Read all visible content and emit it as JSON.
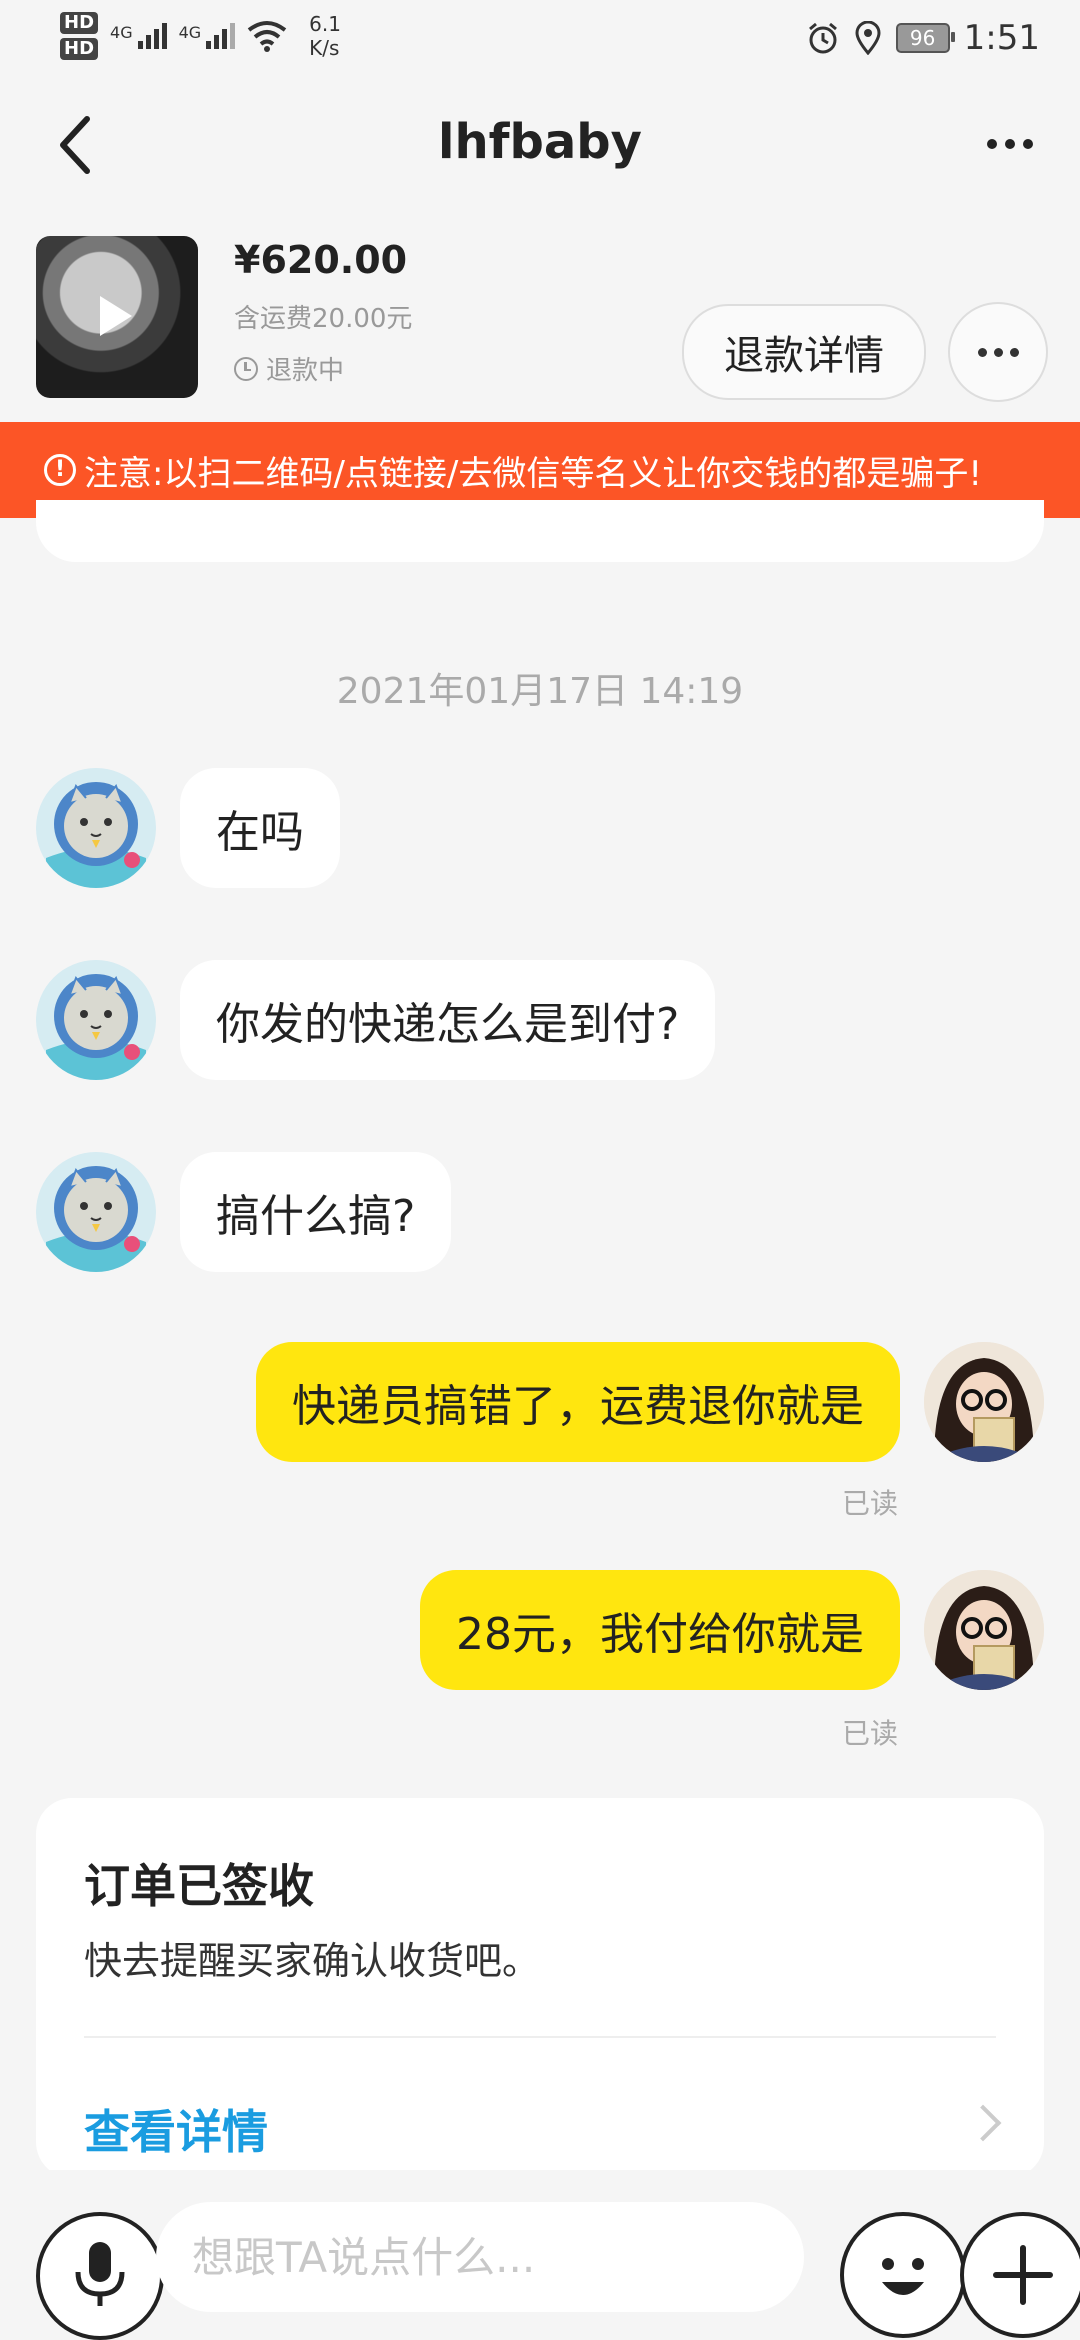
{
  "status_bar": {
    "hd1": "HD",
    "hd2": "HD",
    "net1": "4G",
    "net2": "4G",
    "speed_value": "6.1",
    "speed_unit": "K/s",
    "battery": "96",
    "time": "1:51"
  },
  "header": {
    "title": "lhfbaby"
  },
  "product": {
    "price": "¥620.00",
    "shipping": "含运费20.00元",
    "status": "退款中",
    "refund_button": "退款详情"
  },
  "warning": {
    "icon": "!",
    "text": "注意:以扫二维码/点链接/去微信等名义让你交钱的都是骗子!"
  },
  "chat": {
    "timestamp": "2021年01月17日 14:19",
    "messages": [
      {
        "side": "in",
        "text": "在吗"
      },
      {
        "side": "in",
        "text": "你发的快递怎么是到付?"
      },
      {
        "side": "in",
        "text": "搞什么搞?"
      },
      {
        "side": "out",
        "text": "快递员搞错了，运费退你就是",
        "status": "已读"
      },
      {
        "side": "out",
        "text": "28元，我付给你就是",
        "status": "已读"
      }
    ]
  },
  "order_card": {
    "title": "订单已签收",
    "description": "快去提醒买家确认收货吧。",
    "link": "查看详情"
  },
  "input_bar": {
    "placeholder": "想跟TA说点什么..."
  }
}
